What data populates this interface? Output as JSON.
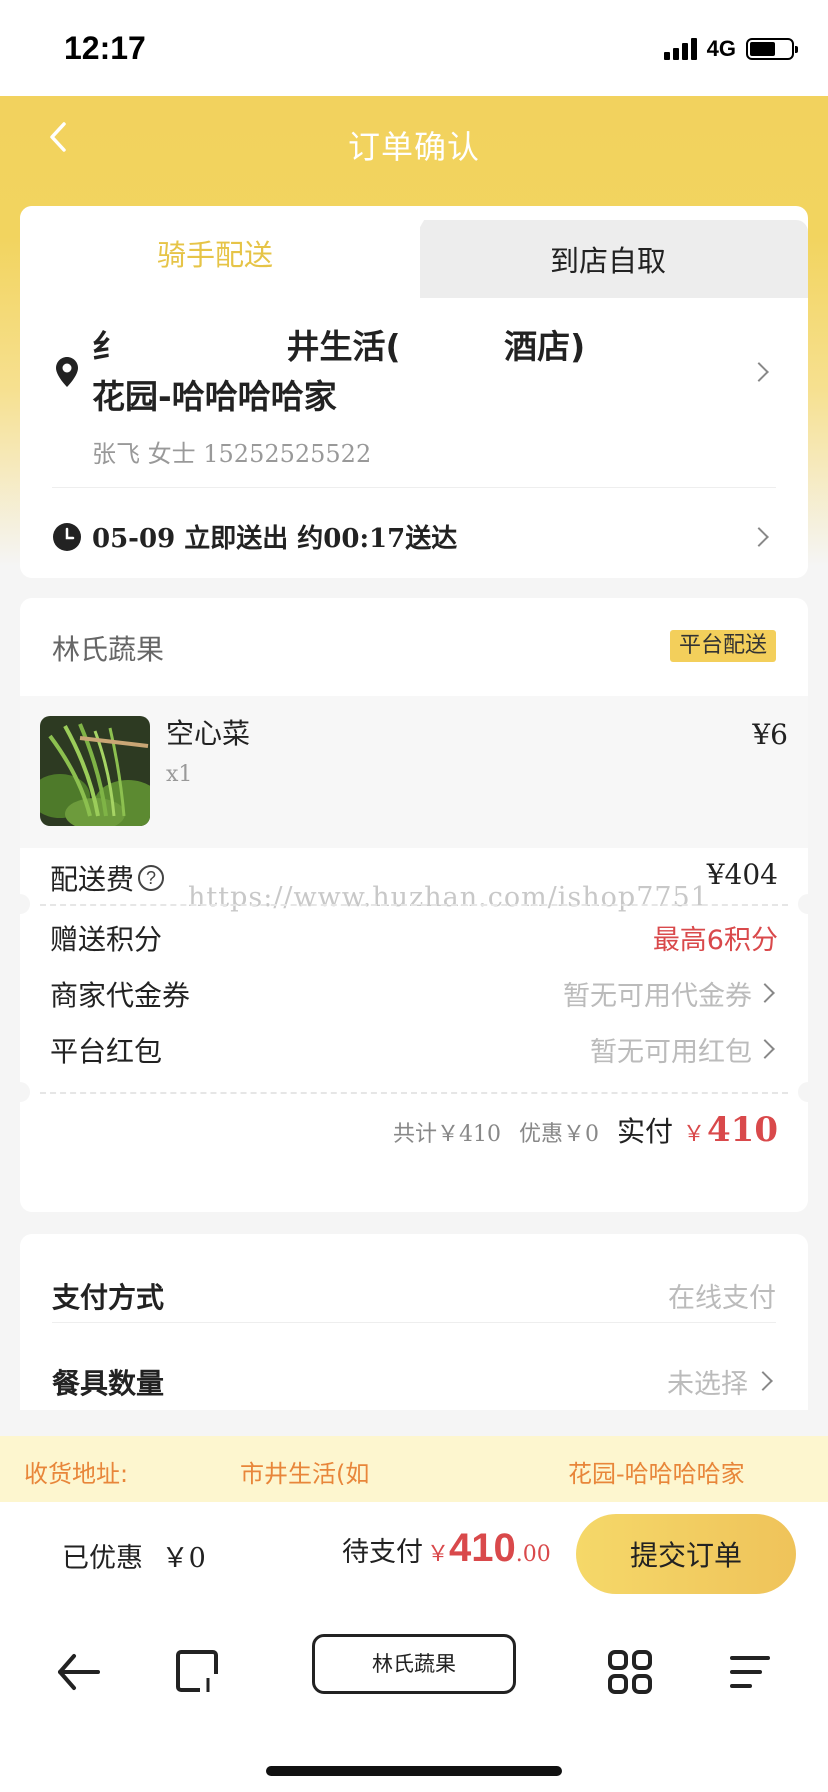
{
  "status_bar": {
    "time": "12:17",
    "network": "4G"
  },
  "nav": {
    "title": "订单确认",
    "back_icon": "chevron-left-icon"
  },
  "delivery_tabs": {
    "rider": "骑手配送",
    "pickup": "到店自取",
    "active": "rider"
  },
  "address": {
    "fragment_1": "纟",
    "fragment_2": "井生活(",
    "fragment_3": "酒店)",
    "line2": "花园-哈哈哈哈家",
    "contact": "张飞 女士 15252525522",
    "icon": "location-pin-icon"
  },
  "delivery_time": {
    "text": "05-09 立即送出 约00:17送达",
    "icon": "clock-icon"
  },
  "order": {
    "shop_name": "林氏蔬果",
    "badge": "平台配送",
    "item": {
      "name": "空心菜",
      "qty": "x1",
      "price": "¥6"
    },
    "delivery_fee_label": "配送费",
    "delivery_fee": "¥404",
    "watermark": "https://www.huzhan.com/ishop7751",
    "points_label": "赠送积分",
    "points_value": "最高6积分",
    "voucher_label": "商家代金券",
    "voucher_value": "暂无可用代金券",
    "redpacket_label": "平台红包",
    "redpacket_value": "暂无可用红包",
    "total_text": "共计￥410",
    "discount_text": "优惠￥0",
    "paid_label": "实付",
    "paid_currency": "￥",
    "paid_value": "410"
  },
  "payment": {
    "method_label": "支付方式",
    "method_value": "在线支付",
    "utensils_label": "餐具数量",
    "utensils_value": "未选择"
  },
  "address_banner": {
    "label": "收货地址:",
    "part_1": "市井生活(如",
    "part_2": "花园-哈哈哈哈家"
  },
  "checkout": {
    "discount_label": "已优惠",
    "discount_value": "￥0",
    "due_label": "待支付",
    "due_currency": "￥",
    "due_integer": "410",
    "due_decimal": ".00",
    "submit": "提交订单"
  },
  "browser_bar": {
    "title": "林氏蔬果",
    "icons": [
      "back-arrow-icon",
      "tabs-icon",
      "grid-apps-icon",
      "menu-icon"
    ]
  },
  "colors": {
    "brand_yellow": "#f2d25e",
    "price_red": "#d9494b",
    "banner_orange": "#e8863a"
  }
}
